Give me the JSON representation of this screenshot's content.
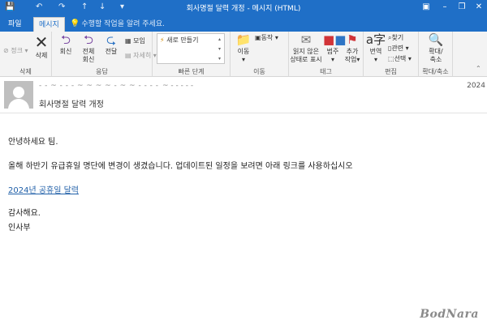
{
  "window": {
    "title": "회사명절 달력 개정 - 메시지 (HTML)",
    "qat": [
      "save-icon",
      "undo-icon",
      "redo-icon",
      "up-icon",
      "down-icon",
      "customize-icon"
    ],
    "controls": [
      "restore-ribbon-icon",
      "minimize-icon",
      "maximize-icon",
      "close-icon"
    ]
  },
  "tabs": {
    "file": "파일",
    "message": "메시지",
    "tell_me": "수행할 작업을 알려 주세요."
  },
  "ribbon": {
    "delete": {
      "junk": "정크",
      "delete": "삭제",
      "group": "삭제"
    },
    "respond": {
      "reply": "회신",
      "reply_all_1": "전체",
      "reply_all_2": "회신",
      "forward": "전달",
      "meeting": "모임",
      "more": "자세히",
      "group": "응답"
    },
    "quick_steps": {
      "new": "새로 만들기",
      "group": "빠른 단계"
    },
    "move": {
      "move": "이동",
      "actions": "동작",
      "group": "이동"
    },
    "tags": {
      "unread_1": "읽지 않은",
      "unread_2": "상태로 표시",
      "categorize": "범주",
      "followup_1": "추가",
      "followup_2": "작업",
      "group": "태그"
    },
    "editing": {
      "translate": "번역",
      "find": "찾기",
      "related": "관련",
      "select": "선택",
      "group": "편집"
    },
    "zoom": {
      "zoom_1": "확대/",
      "zoom_2": "축소",
      "group": "확대/축소"
    }
  },
  "header": {
    "sender": "- - ~ - - - ~ ~ ~ ~ - ~ ~ - - - -",
    "recipient": "~ - - - - -",
    "date": "2024",
    "subject": "회사명절 달력 개정"
  },
  "body": {
    "greeting": "안녕하세요 팀.",
    "message": "올해 하반기 유급휴일 명단에 변경이 생겼습니다. 업데이트된 일정을 보려면 아래 링크를 사용하십시오",
    "link": "2024년 공휴일 달력",
    "closing": "감사해요.",
    "signature": "인사부"
  },
  "watermark": "BodNara"
}
